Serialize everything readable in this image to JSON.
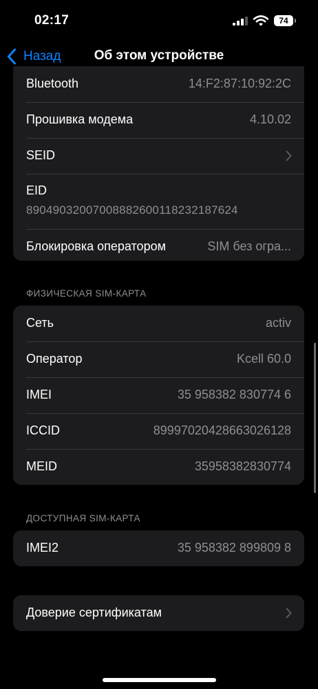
{
  "status_bar": {
    "time": "02:17",
    "battery": "74"
  },
  "nav": {
    "back_label": "Назад",
    "title": "Об этом устройстве"
  },
  "top_group": {
    "bluetooth": {
      "label": "Bluetooth",
      "value": "14:F2:87:10:92:2C"
    },
    "modem": {
      "label": "Прошивка модема",
      "value": "4.10.02"
    },
    "seid": {
      "label": "SEID"
    },
    "eid": {
      "label": "EID",
      "value": "89049032007008882600118232187624"
    },
    "carrier_lock": {
      "label": "Блокировка оператором",
      "value": "SIM без огра..."
    }
  },
  "physical_sim": {
    "header": "ФИЗИЧЕСКАЯ SIM-КАРТА",
    "rows": [
      {
        "label": "Сеть",
        "value": "activ"
      },
      {
        "label": "Оператор",
        "value": "Kcell 60.0"
      },
      {
        "label": "IMEI",
        "value": "35 958382 830774 6"
      },
      {
        "label": "ICCID",
        "value": "89997020428663026128"
      },
      {
        "label": "MEID",
        "value": "35958382830774"
      }
    ]
  },
  "available_sim": {
    "header": "ДОСТУПНАЯ SIM-КАРТА",
    "rows": [
      {
        "label": "IMEI2",
        "value": "35 958382 899809 8"
      }
    ]
  },
  "cert_trust": {
    "label": "Доверие сертификатам"
  },
  "colors": {
    "accent": "#0a84ff",
    "background": "#000000",
    "cell": "#1c1c1e",
    "secondary_text": "#8e8e93"
  },
  "icons": {
    "back": "chevron-left-icon",
    "disclosure": "chevron-right-icon",
    "wifi": "wifi-icon",
    "signal": "cellular-signal-icon",
    "battery": "battery-icon"
  }
}
